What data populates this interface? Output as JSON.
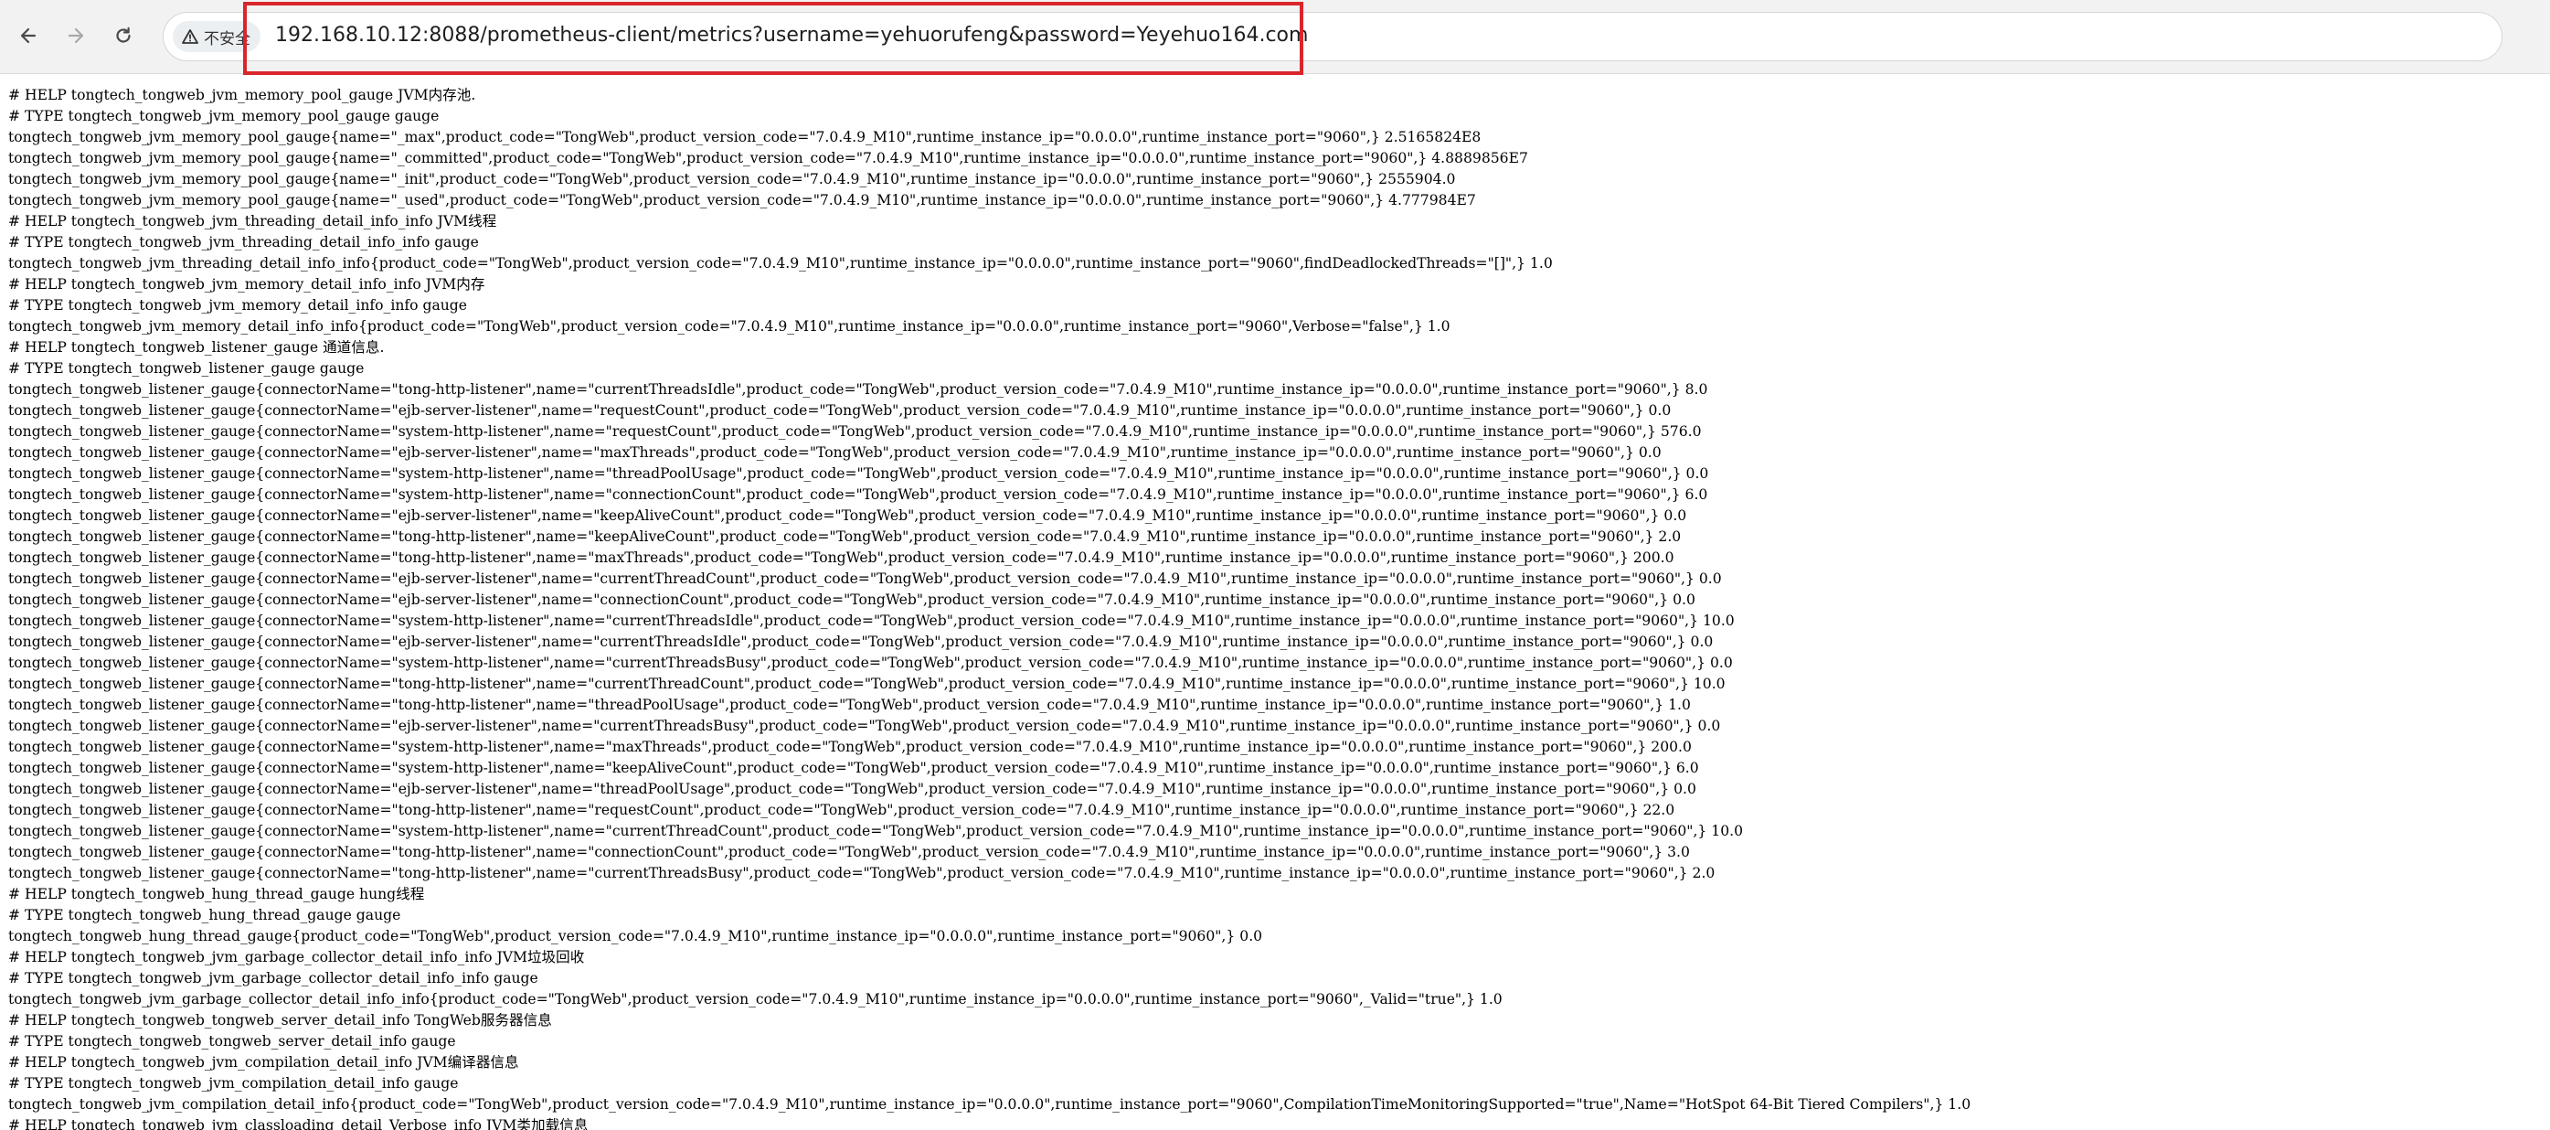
{
  "browser": {
    "security_label": "不安全",
    "url": "192.168.10.12:8088/prometheus-client/metrics?username=yehuorufeng&password=Yeyehuo164.com",
    "annotation_color": "#d9262b"
  },
  "icons": {
    "back": "arrow-left-icon",
    "forward": "arrow-right-icon",
    "reload": "reload-icon",
    "security": "warning-triangle-icon"
  },
  "metrics": {
    "lines": [
      "# HELP tongtech_tongweb_jvm_memory_pool_gauge JVM内存池.",
      "# TYPE tongtech_tongweb_jvm_memory_pool_gauge gauge",
      "tongtech_tongweb_jvm_memory_pool_gauge{name=\"_max\",product_code=\"TongWeb\",product_version_code=\"7.0.4.9_M10\",runtime_instance_ip=\"0.0.0.0\",runtime_instance_port=\"9060\",} 2.5165824E8",
      "tongtech_tongweb_jvm_memory_pool_gauge{name=\"_committed\",product_code=\"TongWeb\",product_version_code=\"7.0.4.9_M10\",runtime_instance_ip=\"0.0.0.0\",runtime_instance_port=\"9060\",} 4.8889856E7",
      "tongtech_tongweb_jvm_memory_pool_gauge{name=\"_init\",product_code=\"TongWeb\",product_version_code=\"7.0.4.9_M10\",runtime_instance_ip=\"0.0.0.0\",runtime_instance_port=\"9060\",} 2555904.0",
      "tongtech_tongweb_jvm_memory_pool_gauge{name=\"_used\",product_code=\"TongWeb\",product_version_code=\"7.0.4.9_M10\",runtime_instance_ip=\"0.0.0.0\",runtime_instance_port=\"9060\",} 4.777984E7",
      "# HELP tongtech_tongweb_jvm_threading_detail_info_info JVM线程",
      "# TYPE tongtech_tongweb_jvm_threading_detail_info_info gauge",
      "tongtech_tongweb_jvm_threading_detail_info_info{product_code=\"TongWeb\",product_version_code=\"7.0.4.9_M10\",runtime_instance_ip=\"0.0.0.0\",runtime_instance_port=\"9060\",findDeadlockedThreads=\"[]\",} 1.0",
      "# HELP tongtech_tongweb_jvm_memory_detail_info_info JVM内存",
      "# TYPE tongtech_tongweb_jvm_memory_detail_info_info gauge",
      "tongtech_tongweb_jvm_memory_detail_info_info{product_code=\"TongWeb\",product_version_code=\"7.0.4.9_M10\",runtime_instance_ip=\"0.0.0.0\",runtime_instance_port=\"9060\",Verbose=\"false\",} 1.0",
      "# HELP tongtech_tongweb_listener_gauge 通道信息.",
      "# TYPE tongtech_tongweb_listener_gauge gauge",
      "tongtech_tongweb_listener_gauge{connectorName=\"tong-http-listener\",name=\"currentThreadsIdle\",product_code=\"TongWeb\",product_version_code=\"7.0.4.9_M10\",runtime_instance_ip=\"0.0.0.0\",runtime_instance_port=\"9060\",} 8.0",
      "tongtech_tongweb_listener_gauge{connectorName=\"ejb-server-listener\",name=\"requestCount\",product_code=\"TongWeb\",product_version_code=\"7.0.4.9_M10\",runtime_instance_ip=\"0.0.0.0\",runtime_instance_port=\"9060\",} 0.0",
      "tongtech_tongweb_listener_gauge{connectorName=\"system-http-listener\",name=\"requestCount\",product_code=\"TongWeb\",product_version_code=\"7.0.4.9_M10\",runtime_instance_ip=\"0.0.0.0\",runtime_instance_port=\"9060\",} 576.0",
      "tongtech_tongweb_listener_gauge{connectorName=\"ejb-server-listener\",name=\"maxThreads\",product_code=\"TongWeb\",product_version_code=\"7.0.4.9_M10\",runtime_instance_ip=\"0.0.0.0\",runtime_instance_port=\"9060\",} 0.0",
      "tongtech_tongweb_listener_gauge{connectorName=\"system-http-listener\",name=\"threadPoolUsage\",product_code=\"TongWeb\",product_version_code=\"7.0.4.9_M10\",runtime_instance_ip=\"0.0.0.0\",runtime_instance_port=\"9060\",} 0.0",
      "tongtech_tongweb_listener_gauge{connectorName=\"system-http-listener\",name=\"connectionCount\",product_code=\"TongWeb\",product_version_code=\"7.0.4.9_M10\",runtime_instance_ip=\"0.0.0.0\",runtime_instance_port=\"9060\",} 6.0",
      "tongtech_tongweb_listener_gauge{connectorName=\"ejb-server-listener\",name=\"keepAliveCount\",product_code=\"TongWeb\",product_version_code=\"7.0.4.9_M10\",runtime_instance_ip=\"0.0.0.0\",runtime_instance_port=\"9060\",} 0.0",
      "tongtech_tongweb_listener_gauge{connectorName=\"tong-http-listener\",name=\"keepAliveCount\",product_code=\"TongWeb\",product_version_code=\"7.0.4.9_M10\",runtime_instance_ip=\"0.0.0.0\",runtime_instance_port=\"9060\",} 2.0",
      "tongtech_tongweb_listener_gauge{connectorName=\"tong-http-listener\",name=\"maxThreads\",product_code=\"TongWeb\",product_version_code=\"7.0.4.9_M10\",runtime_instance_ip=\"0.0.0.0\",runtime_instance_port=\"9060\",} 200.0",
      "tongtech_tongweb_listener_gauge{connectorName=\"ejb-server-listener\",name=\"currentThreadCount\",product_code=\"TongWeb\",product_version_code=\"7.0.4.9_M10\",runtime_instance_ip=\"0.0.0.0\",runtime_instance_port=\"9060\",} 0.0",
      "tongtech_tongweb_listener_gauge{connectorName=\"ejb-server-listener\",name=\"connectionCount\",product_code=\"TongWeb\",product_version_code=\"7.0.4.9_M10\",runtime_instance_ip=\"0.0.0.0\",runtime_instance_port=\"9060\",} 0.0",
      "tongtech_tongweb_listener_gauge{connectorName=\"system-http-listener\",name=\"currentThreadsIdle\",product_code=\"TongWeb\",product_version_code=\"7.0.4.9_M10\",runtime_instance_ip=\"0.0.0.0\",runtime_instance_port=\"9060\",} 10.0",
      "tongtech_tongweb_listener_gauge{connectorName=\"ejb-server-listener\",name=\"currentThreadsIdle\",product_code=\"TongWeb\",product_version_code=\"7.0.4.9_M10\",runtime_instance_ip=\"0.0.0.0\",runtime_instance_port=\"9060\",} 0.0",
      "tongtech_tongweb_listener_gauge{connectorName=\"system-http-listener\",name=\"currentThreadsBusy\",product_code=\"TongWeb\",product_version_code=\"7.0.4.9_M10\",runtime_instance_ip=\"0.0.0.0\",runtime_instance_port=\"9060\",} 0.0",
      "tongtech_tongweb_listener_gauge{connectorName=\"tong-http-listener\",name=\"currentThreadCount\",product_code=\"TongWeb\",product_version_code=\"7.0.4.9_M10\",runtime_instance_ip=\"0.0.0.0\",runtime_instance_port=\"9060\",} 10.0",
      "tongtech_tongweb_listener_gauge{connectorName=\"tong-http-listener\",name=\"threadPoolUsage\",product_code=\"TongWeb\",product_version_code=\"7.0.4.9_M10\",runtime_instance_ip=\"0.0.0.0\",runtime_instance_port=\"9060\",} 1.0",
      "tongtech_tongweb_listener_gauge{connectorName=\"ejb-server-listener\",name=\"currentThreadsBusy\",product_code=\"TongWeb\",product_version_code=\"7.0.4.9_M10\",runtime_instance_ip=\"0.0.0.0\",runtime_instance_port=\"9060\",} 0.0",
      "tongtech_tongweb_listener_gauge{connectorName=\"system-http-listener\",name=\"maxThreads\",product_code=\"TongWeb\",product_version_code=\"7.0.4.9_M10\",runtime_instance_ip=\"0.0.0.0\",runtime_instance_port=\"9060\",} 200.0",
      "tongtech_tongweb_listener_gauge{connectorName=\"system-http-listener\",name=\"keepAliveCount\",product_code=\"TongWeb\",product_version_code=\"7.0.4.9_M10\",runtime_instance_ip=\"0.0.0.0\",runtime_instance_port=\"9060\",} 6.0",
      "tongtech_tongweb_listener_gauge{connectorName=\"ejb-server-listener\",name=\"threadPoolUsage\",product_code=\"TongWeb\",product_version_code=\"7.0.4.9_M10\",runtime_instance_ip=\"0.0.0.0\",runtime_instance_port=\"9060\",} 0.0",
      "tongtech_tongweb_listener_gauge{connectorName=\"tong-http-listener\",name=\"requestCount\",product_code=\"TongWeb\",product_version_code=\"7.0.4.9_M10\",runtime_instance_ip=\"0.0.0.0\",runtime_instance_port=\"9060\",} 22.0",
      "tongtech_tongweb_listener_gauge{connectorName=\"system-http-listener\",name=\"currentThreadCount\",product_code=\"TongWeb\",product_version_code=\"7.0.4.9_M10\",runtime_instance_ip=\"0.0.0.0\",runtime_instance_port=\"9060\",} 10.0",
      "tongtech_tongweb_listener_gauge{connectorName=\"tong-http-listener\",name=\"connectionCount\",product_code=\"TongWeb\",product_version_code=\"7.0.4.9_M10\",runtime_instance_ip=\"0.0.0.0\",runtime_instance_port=\"9060\",} 3.0",
      "tongtech_tongweb_listener_gauge{connectorName=\"tong-http-listener\",name=\"currentThreadsBusy\",product_code=\"TongWeb\",product_version_code=\"7.0.4.9_M10\",runtime_instance_ip=\"0.0.0.0\",runtime_instance_port=\"9060\",} 2.0",
      "# HELP tongtech_tongweb_hung_thread_gauge hung线程",
      "# TYPE tongtech_tongweb_hung_thread_gauge gauge",
      "tongtech_tongweb_hung_thread_gauge{product_code=\"TongWeb\",product_version_code=\"7.0.4.9_M10\",runtime_instance_ip=\"0.0.0.0\",runtime_instance_port=\"9060\",} 0.0",
      "# HELP tongtech_tongweb_jvm_garbage_collector_detail_info_info JVM垃圾回收",
      "# TYPE tongtech_tongweb_jvm_garbage_collector_detail_info_info gauge",
      "tongtech_tongweb_jvm_garbage_collector_detail_info_info{product_code=\"TongWeb\",product_version_code=\"7.0.4.9_M10\",runtime_instance_ip=\"0.0.0.0\",runtime_instance_port=\"9060\",_Valid=\"true\",} 1.0",
      "# HELP tongtech_tongweb_tongweb_server_detail_info TongWeb服务器信息",
      "# TYPE tongtech_tongweb_tongweb_server_detail_info gauge",
      "# HELP tongtech_tongweb_jvm_compilation_detail_info JVM编译器信息",
      "# TYPE tongtech_tongweb_jvm_compilation_detail_info gauge",
      "tongtech_tongweb_jvm_compilation_detail_info{product_code=\"TongWeb\",product_version_code=\"7.0.4.9_M10\",runtime_instance_ip=\"0.0.0.0\",runtime_instance_port=\"9060\",CompilationTimeMonitoringSupported=\"true\",Name=\"HotSpot 64-Bit Tiered Compilers\",} 1.0",
      "# HELP tongtech_tongweb_jvm_classloading_detail_Verbose_info JVM类加载信息"
    ]
  }
}
